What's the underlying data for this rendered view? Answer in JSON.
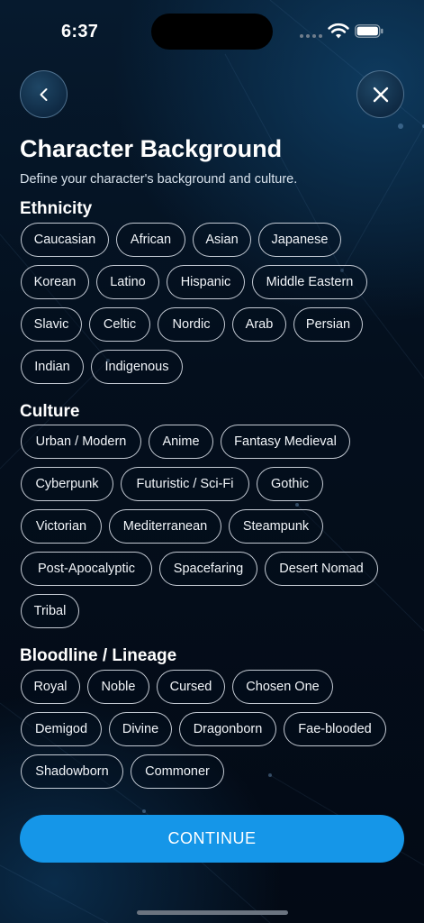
{
  "status_bar": {
    "time": "6:37"
  },
  "header": {
    "title": "Character Background",
    "subtitle": "Define your character's background and culture."
  },
  "sections": {
    "ethnicity": {
      "label": "Ethnicity",
      "options": [
        "Caucasian",
        "African",
        "Asian",
        "Japanese",
        "Korean",
        "Latino",
        "Hispanic",
        "Middle Eastern",
        "Slavic",
        "Celtic",
        "Nordic",
        "Arab",
        "Persian",
        "Indian",
        "Indigenous"
      ]
    },
    "culture": {
      "label": "Culture",
      "options": [
        "Urban / Modern",
        "Anime",
        "Fantasy Medieval",
        "Cyberpunk",
        "Futuristic / Sci-Fi",
        "Gothic",
        "Victorian",
        "Mediterranean",
        "Steampunk",
        "Post-Apocalyptic",
        "Spacefaring",
        "Desert Nomad",
        "Tribal"
      ]
    },
    "bloodline": {
      "label": "Bloodline / Lineage",
      "options": [
        "Royal",
        "Noble",
        "Cursed",
        "Chosen One",
        "Demigod",
        "Divine",
        "Dragonborn",
        "Fae-blooded",
        "Shadowborn",
        "Commoner"
      ]
    }
  },
  "footer": {
    "continue_label": "CONTINUE"
  },
  "icons": {
    "back": "chevron-left-icon",
    "close": "close-icon",
    "wifi": "wifi-icon",
    "battery": "battery-icon",
    "signal": "signal-icon"
  },
  "colors": {
    "accent": "#1596e8",
    "background": "#040f1d",
    "chip_border": "#e6ecf5"
  }
}
